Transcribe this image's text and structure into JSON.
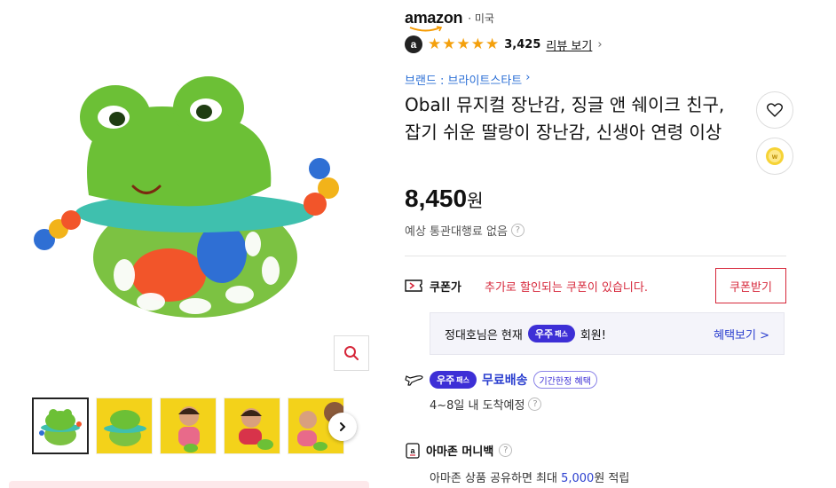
{
  "store": {
    "logo_text": "amazon",
    "country": "· 미국"
  },
  "rating": {
    "badge": "a",
    "stars": 5,
    "count": "3,425",
    "link": "리뷰 보기"
  },
  "brand": {
    "label": "브랜드 : 브라이트스타트"
  },
  "product": {
    "title": "Oball 뮤지컬 장난감, 징글 앤 쉐이크 친구, 잡기 쉬운 딸랑이 장난감, 신생아 연령 이상",
    "price": "8,450",
    "currency": "원",
    "customs": "예상 통관대행료 없음"
  },
  "coupon": {
    "label": "쿠폰가",
    "message": "추가로 할인되는 쿠폰이 있습니다.",
    "button": "쿠폰받기"
  },
  "membership": {
    "name_text": "정대호님은 현재",
    "pass_main": "우주",
    "pass_sub": "패스",
    "suffix": "회원!",
    "link": "혜택보기 >"
  },
  "shipping": {
    "pass_main": "우주",
    "pass_sub": "패스",
    "free": "무료배송",
    "badge": "기간한정 혜택",
    "arrival": "4~8일 내 도착예정"
  },
  "money": {
    "title": "아마존 머니백",
    "desc_prefix": "아마존 상품 공유하면 최대",
    "amount": "5,000",
    "desc_suffix": "원 적립"
  },
  "gallery": {
    "thumb_count": 5,
    "selected": 0
  },
  "colors": {
    "accent": "#d6273a",
    "link": "#2b6fd6",
    "pass": "#3d2fd6",
    "star": "#f4a00c"
  }
}
